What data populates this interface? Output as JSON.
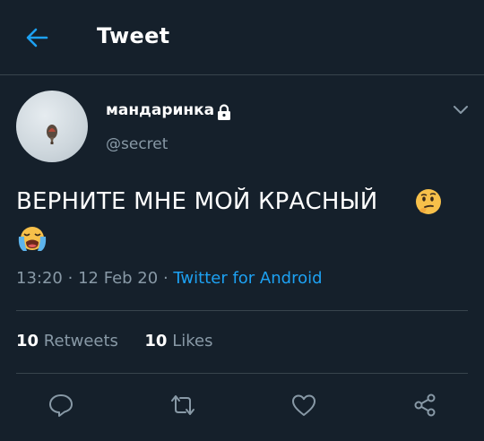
{
  "header": {
    "title": "Tweet"
  },
  "tweet": {
    "display_name": "мандаринка",
    "handle": "@secret",
    "text": "ВЕРНИТЕ МНЕ МОЙ КРАСНЫЙ",
    "time": "13:20",
    "date": "12 Feb 20",
    "source": "Twitter for Android",
    "separator": "·"
  },
  "stats": {
    "retweets_count": "10",
    "retweets_label": "Retweets",
    "likes_count": "10",
    "likes_label": "Likes"
  },
  "icons": {
    "back": "arrow-left-icon",
    "lock": "lock-icon",
    "caret": "chevron-down-icon",
    "emoji1": "thinking-face-emoji",
    "emoji2": "loudly-crying-face-emoji",
    "reply": "reply-icon",
    "retweet": "retweet-icon",
    "like": "heart-icon",
    "share": "share-icon"
  },
  "colors": {
    "background": "#15202b",
    "accent": "#1da1f2",
    "secondary_text": "#8899a6",
    "divider": "#38444d"
  }
}
